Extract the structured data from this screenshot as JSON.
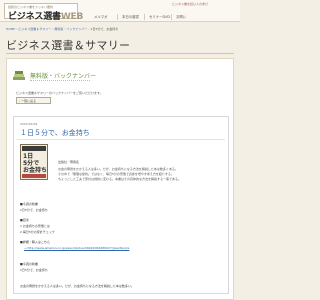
{
  "header": {
    "logo_sub": "話題のビジネス書をスッキリ要約",
    "logo_main": "ビジネス選書",
    "logo_web": "WEB",
    "tagline": "ビジネス書を読む人の学び",
    "nav": [
      "メルマガ",
      "本日の選書",
      "セミナーDVD",
      "お問い"
    ]
  },
  "breadcrumb": [
    "HOME",
    "ビジネス選書＆サマリー",
    "無料版・バックナンバー",
    "1日5分で、お金持ち"
  ],
  "page": {
    "title": "ビジネス選書＆サマリー"
  },
  "category": {
    "heading": "無料版・バックナンバー",
    "intro": "ビジネス選書＆サマリーのバックナンバーをご覧いただけます。",
    "back_button": "一覧に戻る"
  },
  "article": {
    "date": "2007/01/09",
    "title": "１日５分で、お金持ち",
    "book_cover_text": [
      "1日",
      "5分で",
      "お金持ち"
    ],
    "info": "出版社／著者名",
    "lead": [
      "お金の問題をかかえる人は多い。だが、お金持ちになる方法を解説した本は数多くある。",
      "その中で「無理な節約」ではなく、毎日5分の習慣で資産を増やす考え方を紹介する。",
      "ちょっとした工夫で家計は劇的に変わる。本書はその具体的な方法を解説する一冊である。"
    ],
    "sections": [
      {
        "heading": "■今週の新書",
        "lines": [
          "1日5分で、お金持ち"
        ]
      },
      {
        "heading": "■目次",
        "lines": [
          "1 お金持ちの習慣とは",
          "2 毎日5分の家計チェック"
        ]
      },
      {
        "heading": "■詳細・購入はこちら",
        "link": "→ http://www.amazon.co.jp/exec/obidos/ASIN/4062686027/jpsellbooks"
      },
      {
        "heading": "■今週の新書",
        "lines": [
          "1日5分で、お金持ち"
        ]
      }
    ],
    "footer_lines": [
      "お金の問題をかかえる人は多い。だが、お金持ちになる方法を解説した本は数多い。"
    ]
  }
}
